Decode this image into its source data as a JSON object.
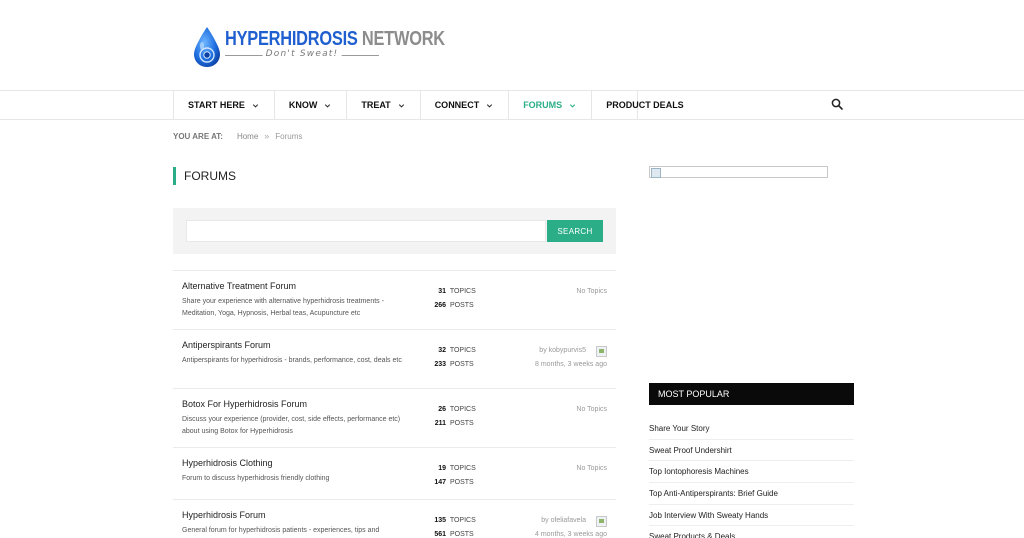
{
  "logo": {
    "title_part1": "HYPERHIDROSIS",
    "title_part2": " NETWORK",
    "tagline": "Don't Sweat!",
    "color_primary": "#1f5fcf",
    "color_secondary": "#8c8c8c"
  },
  "nav": {
    "items": [
      {
        "label": "START HERE",
        "has_dropdown": true
      },
      {
        "label": "KNOW",
        "has_dropdown": true
      },
      {
        "label": "TREAT",
        "has_dropdown": true
      },
      {
        "label": "CONNECT",
        "has_dropdown": true
      },
      {
        "label": "FORUMS",
        "has_dropdown": true,
        "active": true
      },
      {
        "label": "PRODUCT DEALS",
        "has_dropdown": false
      }
    ],
    "search_icon": "search-icon",
    "accent_color": "#2bae87"
  },
  "breadcrumb": {
    "label": "YOU ARE AT:",
    "home": "Home",
    "separator": "»",
    "current": "Forums"
  },
  "page": {
    "title": "FORUMS"
  },
  "search": {
    "value": "",
    "button_label": "SEARCH"
  },
  "forums": [
    {
      "title": "Alternative Treatment Forum",
      "description": "Share your experience with alternative hyperhidrosis treatments - Meditation, Yoga, Hypnosis, Herbal teas, Acupuncture etc",
      "topics": "31",
      "posts": "266",
      "last_line1": "No Topics",
      "last_line2": "",
      "has_avatar": false
    },
    {
      "title": "Antiperspirants Forum",
      "description": "Antiperspirants for hyperhidrosis - brands, performance, cost, deals etc",
      "topics": "32",
      "posts": "233",
      "last_line1": "by kobypurvis5",
      "last_line2": "8 months, 3 weeks ago",
      "has_avatar": true
    },
    {
      "title": "Botox For Hyperhidrosis Forum",
      "description": "Discuss your experience (provider, cost, side effects, performance etc) about using Botox for Hyperhidrosis",
      "topics": "26",
      "posts": "211",
      "last_line1": "No Topics",
      "last_line2": "",
      "has_avatar": false
    },
    {
      "title": "Hyperhidrosis Clothing",
      "description": "Forum to discuss hyperhidrosis friendly clothing",
      "topics": "19",
      "posts": "147",
      "last_line1": "No Topics",
      "last_line2": "",
      "has_avatar": false
    },
    {
      "title": "Hyperhidrosis Forum",
      "description": "General forum for hyperhidrosis patients - experiences, tips and",
      "topics": "135",
      "posts": "561",
      "last_line1": "by ofeliafavela",
      "last_line2": "4 months, 3 weeks ago",
      "has_avatar": true
    }
  ],
  "stat_labels": {
    "topics": "TOPICS",
    "posts": "POSTS"
  },
  "sidebar": {
    "popular_heading": "MOST POPULAR",
    "popular": [
      "Share Your Story",
      "Sweat Proof Undershirt",
      "Top Iontophoresis Machines",
      "Top Anti-Antiperspirants: Brief Guide",
      "Job Interview With Sweaty Hands",
      "Sweat Products & Deals"
    ]
  }
}
